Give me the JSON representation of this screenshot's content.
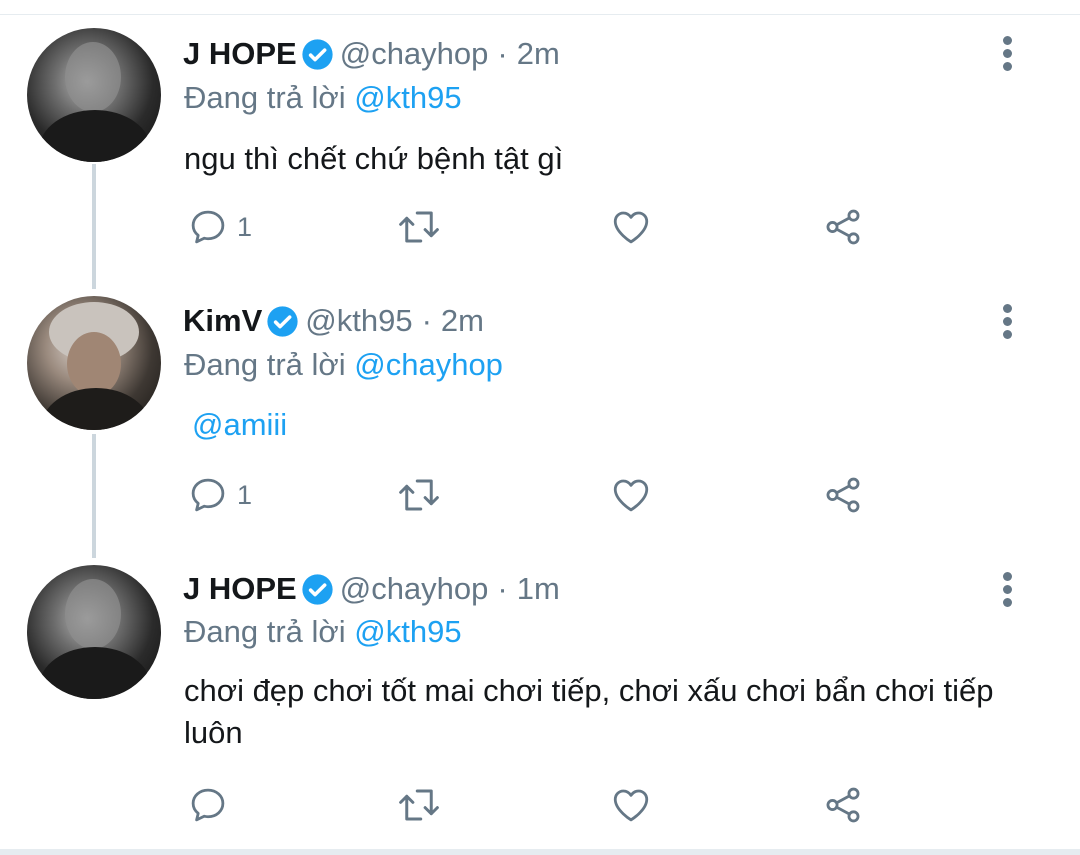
{
  "tweets": [
    {
      "name": "J HOPE",
      "handle": "@chayhop",
      "separator": "·",
      "time": "2m",
      "reply_prefix": "Đang trả lời",
      "reply_to": "@kth95",
      "text": "ngu thì chết chứ bệnh tật gì",
      "reply_count": "1",
      "avatar": "jhope-avatar"
    },
    {
      "name": "KimV",
      "handle": "@kth95",
      "separator": "·",
      "time": "2m",
      "reply_prefix": "Đang trả lời",
      "reply_to": "@chayhop",
      "text": "@amiii",
      "reply_count": "1",
      "avatar": "kimv-avatar"
    },
    {
      "name": "J HOPE",
      "handle": "@chayhop",
      "separator": "·",
      "time": "1m",
      "reply_prefix": "Đang trả lời",
      "reply_to": "@kth95",
      "text": "chơi đẹp chơi tốt mai chơi tiếp, chơi xấu chơi bẩn chơi tiếp luôn",
      "reply_count": "",
      "avatar": "jhope-avatar"
    }
  ],
  "colors": {
    "accent": "#1da1f2",
    "secondary_text": "#657786",
    "primary_text": "#14171a",
    "icon_gray": "#657786"
  },
  "icons": [
    "reply-icon",
    "retweet-icon",
    "like-icon",
    "share-icon",
    "verified-badge-icon",
    "more-options-icon"
  ]
}
